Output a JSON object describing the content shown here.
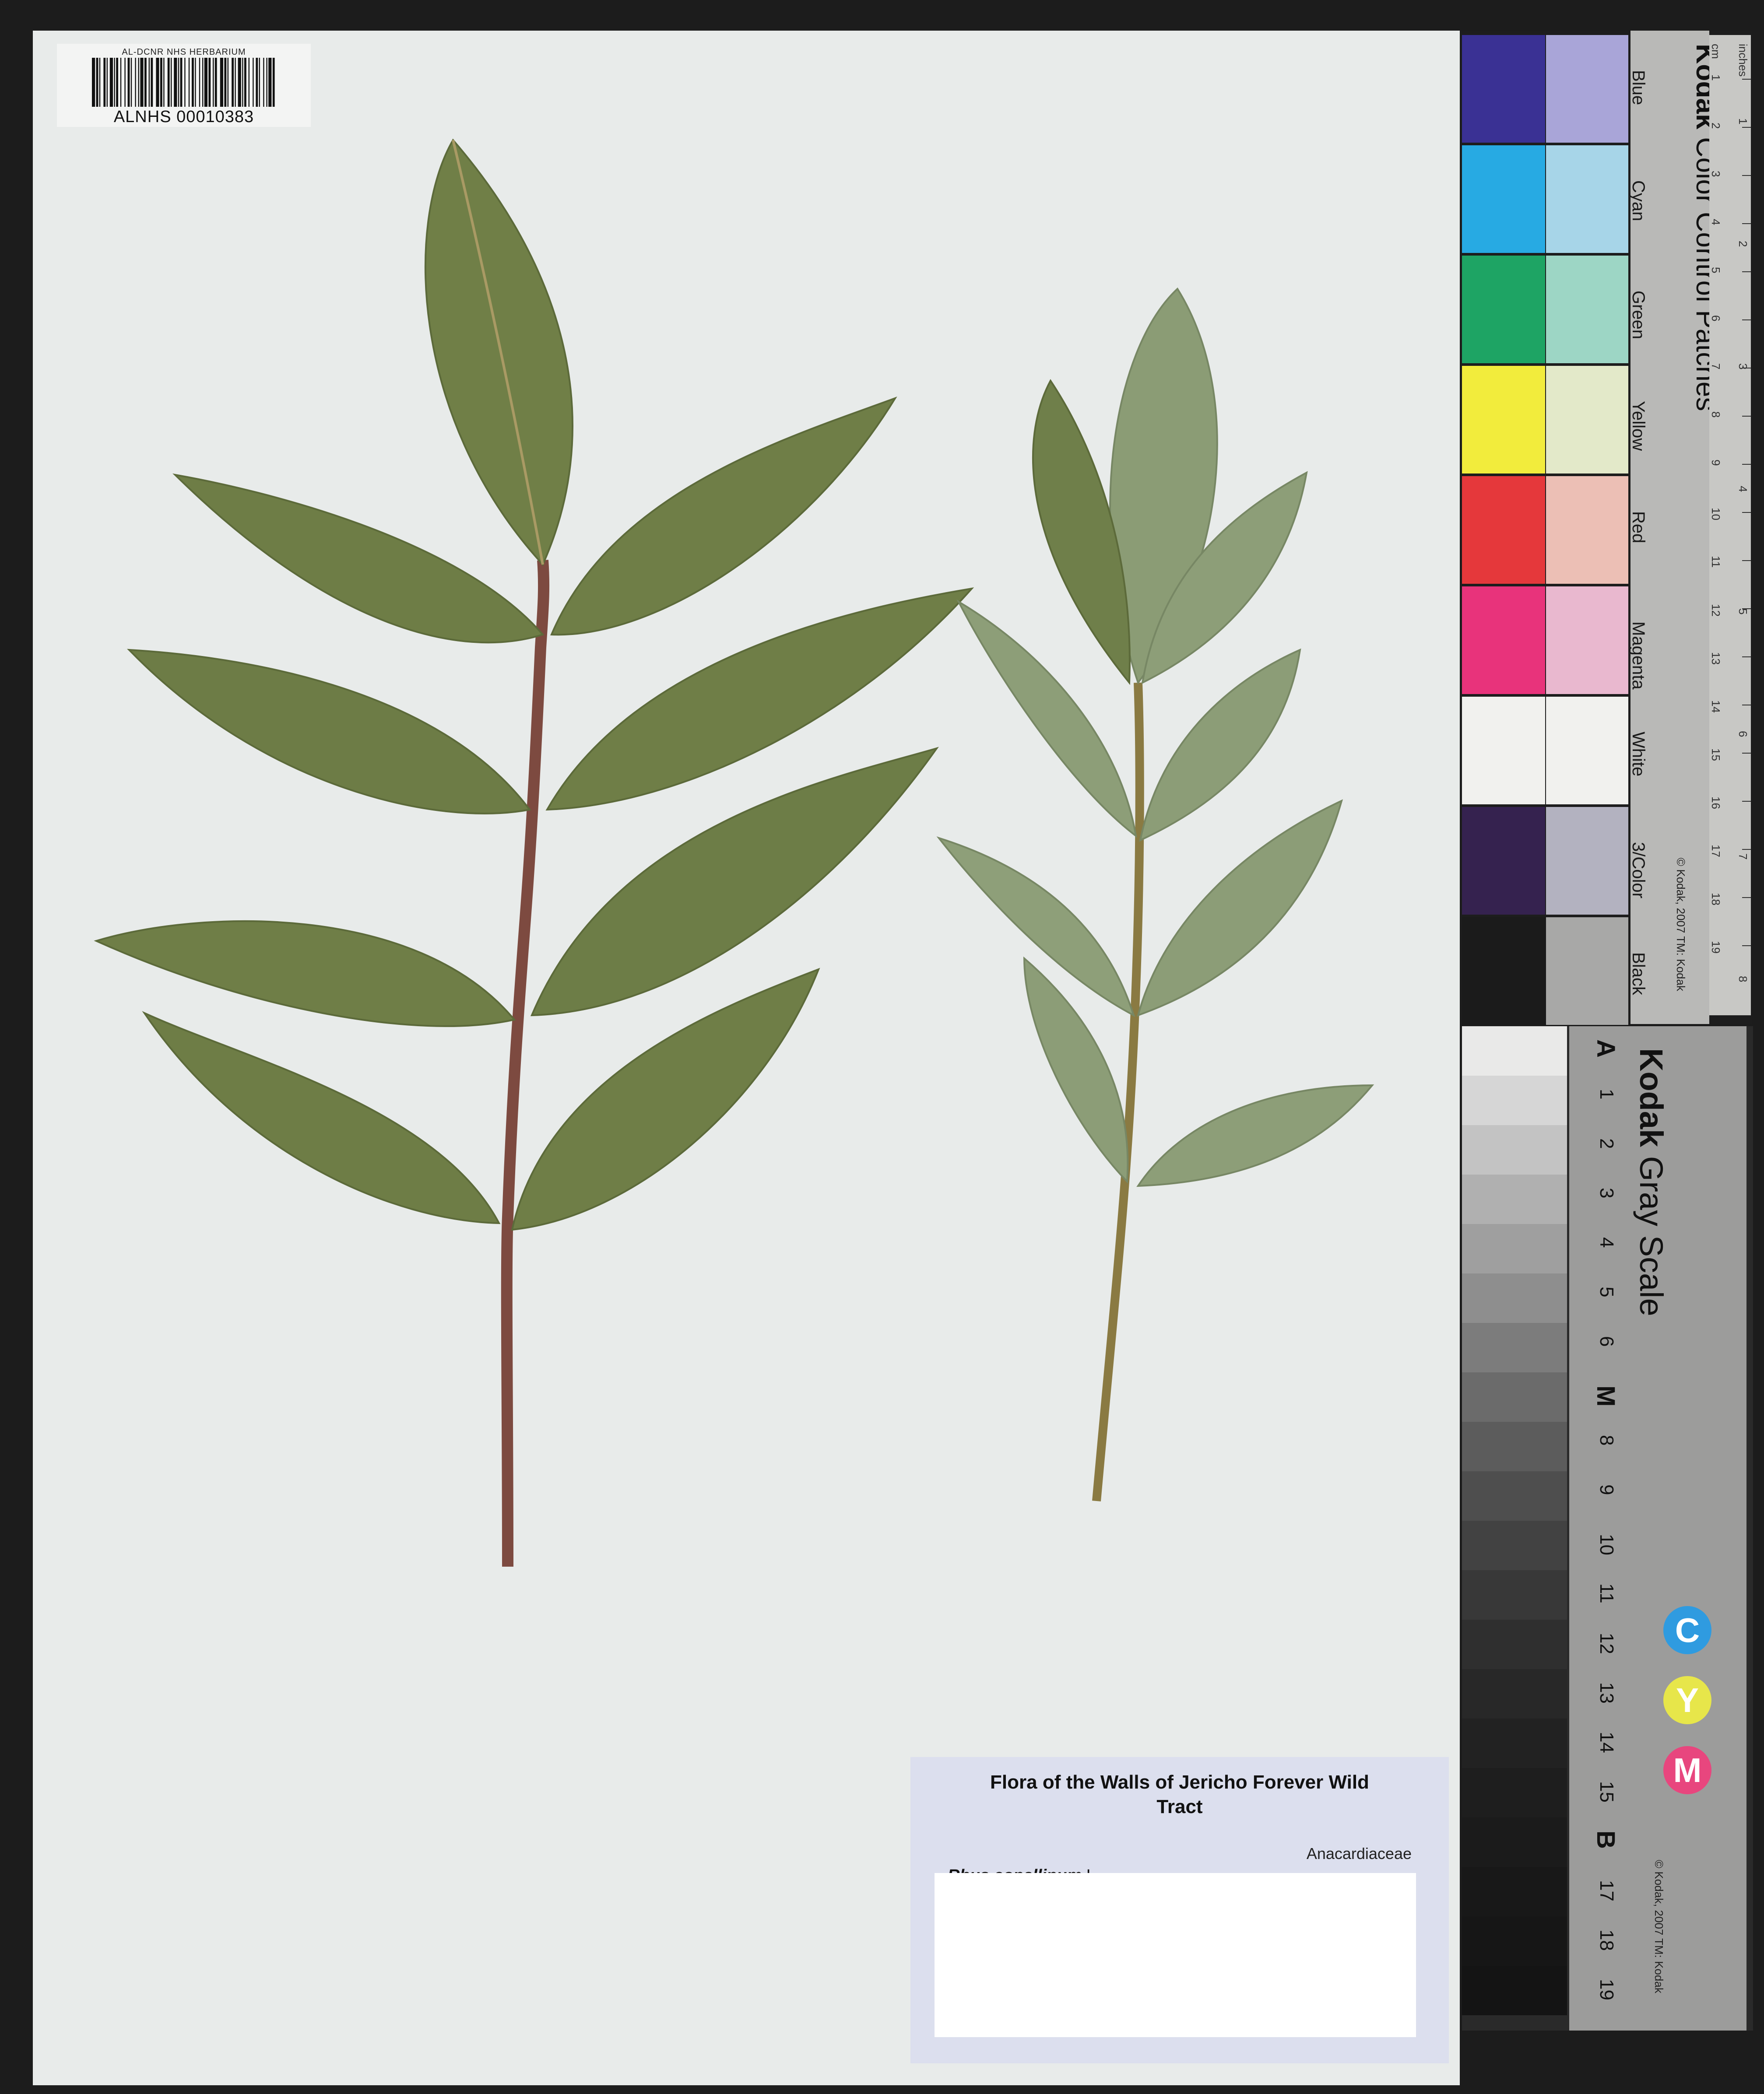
{
  "barcode": {
    "header": "AL-DCNR NHS HERBARIUM",
    "number": "ALNHS 00010383"
  },
  "label": {
    "title_line1": "Flora of  the Walls of Jericho Forever Wild",
    "title_line2": "Tract",
    "family": "Anacardiaceae",
    "genus_species": "Rhus copallinum",
    "author": "L."
  },
  "color_card": {
    "brand": "Kodak",
    "title": "Color Control Patches",
    "copyright": "© Kodak, 2007  TM: Kodak",
    "patches": [
      {
        "label": "Blue",
        "dark": "#3a3194",
        "light": "#a9a5d8"
      },
      {
        "label": "Cyan",
        "dark": "#27aae3",
        "light": "#a7d5e8"
      },
      {
        "label": "Green",
        "dark": "#1ea464",
        "light": "#9dd6c5"
      },
      {
        "label": "Yellow",
        "dark": "#f2ec3c",
        "light": "#e3e9c9"
      },
      {
        "label": "Red",
        "dark": "#e5383b",
        "light": "#ecbfb5"
      },
      {
        "label": "Magenta",
        "dark": "#e8337b",
        "light": "#e9b8cf"
      },
      {
        "label": "White",
        "dark": "#f1f1ee",
        "light": "#f1f1ee"
      },
      {
        "label": "3/Color",
        "dark": "#35224f",
        "light": "#b3b2c0"
      },
      {
        "label": "Black",
        "dark": "#1b1b1b",
        "light": "#a8a8a7"
      }
    ],
    "ruler_unit_cm": "cm",
    "ruler_unit_in": "inches",
    "ruler_cm": [
      "1",
      "2",
      "3",
      "4",
      "5",
      "6",
      "7",
      "8",
      "9",
      "10",
      "11",
      "12",
      "13",
      "14",
      "15",
      "16",
      "17",
      "18",
      "19"
    ],
    "ruler_in": [
      "1",
      "2",
      "3",
      "4",
      "5",
      "6",
      "7",
      "8"
    ]
  },
  "gray_card": {
    "brand": "Kodak",
    "title": "Gray Scale",
    "copyright": "© Kodak, 2007  TM: Kodak",
    "steps": [
      "A",
      "1",
      "2",
      "3",
      "4",
      "5",
      "6",
      "M",
      "8",
      "9",
      "10",
      "11",
      "12",
      "13",
      "14",
      "15",
      "B",
      "17",
      "18",
      "19"
    ],
    "tones": [
      "#e9e9e8",
      "#d6d6d6",
      "#c3c3c3",
      "#b0b0b0",
      "#9f9f9f",
      "#8e8e8e",
      "#7c7c7c",
      "#6b6b6b",
      "#5c5c5c",
      "#4e4e4e",
      "#424242",
      "#383838",
      "#2f2f2f",
      "#282828",
      "#222222",
      "#1e1e1e",
      "#1b1b1b",
      "#181818",
      "#161616",
      "#141414"
    ],
    "cym": [
      {
        "letter": "C",
        "color": "#2f9be0"
      },
      {
        "letter": "Y",
        "color": "#e7e64a"
      },
      {
        "letter": "M",
        "color": "#e8467e"
      }
    ]
  },
  "colors": {
    "sheet": "#e8ebea",
    "leaf_dark": "#6f8048",
    "leaf_light": "#8fa079",
    "stem": "#8a4a44"
  }
}
